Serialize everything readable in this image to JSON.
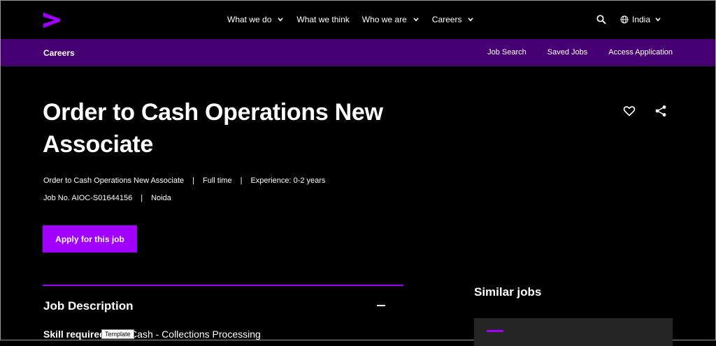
{
  "header": {
    "logo": "greater-than-logo",
    "nav": [
      {
        "label": "What we do",
        "has_dropdown": true
      },
      {
        "label": "What we think",
        "has_dropdown": false
      },
      {
        "label": "Who we are",
        "has_dropdown": true
      },
      {
        "label": "Careers",
        "has_dropdown": true
      }
    ],
    "region": "India"
  },
  "subnav": {
    "brand": "Careers",
    "links": [
      "Job Search",
      "Saved Jobs",
      "Access Application"
    ]
  },
  "job": {
    "title": "Order to Cash Operations New Associate",
    "role": "Order to Cash Operations New Associate",
    "type": "Full time",
    "experience": "Experience: 0-2 years",
    "job_no": "Job No. AIOC-S01644156",
    "location": "Noida",
    "apply_label": "Apply for this job",
    "separator": "|"
  },
  "description": {
    "heading": "Job Description",
    "skill_label": "Skill required",
    "skill_value": "to Cash - Collections Processing",
    "tooltip": "Template"
  },
  "similar": {
    "heading": "Similar jobs"
  },
  "colors": {
    "accent": "#a100ff",
    "subnav_bg": "#460073",
    "background": "#000000"
  }
}
